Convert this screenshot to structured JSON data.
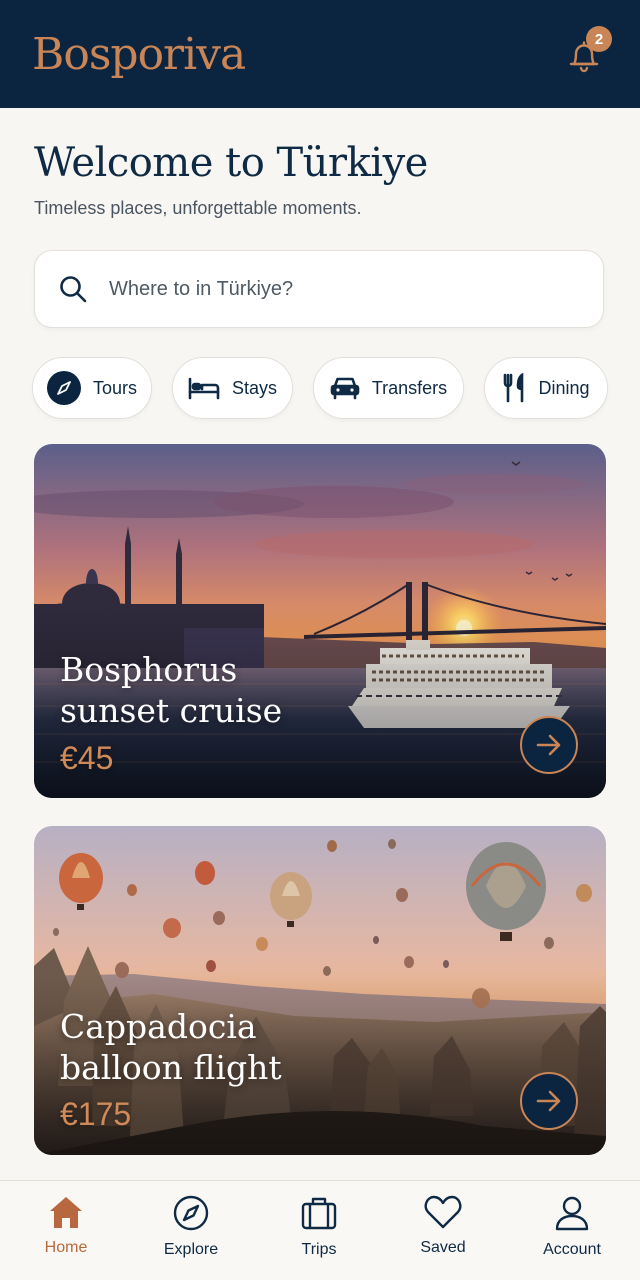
{
  "header": {
    "logo": "Bosporiva",
    "notifications_count": "2",
    "bell_icon": "bell-icon"
  },
  "welcome": {
    "title": "Welcome to Türkiye",
    "subtitle": "Timeless places, unforgettable moments."
  },
  "search": {
    "placeholder": "Where to in Türkiye?",
    "value": "",
    "icon": "search-icon"
  },
  "categories": [
    {
      "label": "Tours",
      "icon": "compass-icon"
    },
    {
      "label": "Stays",
      "icon": "bed-icon"
    },
    {
      "label": "Transfers",
      "icon": "car-icon"
    },
    {
      "label": "Dining",
      "icon": "fork-knife-icon"
    }
  ],
  "cards": [
    {
      "title_line1": "Bosphorus",
      "title_line2": "sunset cruise",
      "price": "€45",
      "icon": "arrow-right-icon"
    },
    {
      "title_line1": "Cappadocia",
      "title_line2": "balloon flight",
      "price": "€175",
      "icon": "arrow-right-icon"
    }
  ],
  "bottom_nav": [
    {
      "label": "Home",
      "icon": "home-icon",
      "active": true
    },
    {
      "label": "Explore",
      "icon": "compass-icon",
      "active": false
    },
    {
      "label": "Trips",
      "icon": "suitcase-icon",
      "active": false
    },
    {
      "label": "Saved",
      "icon": "heart-icon",
      "active": false
    },
    {
      "label": "Account",
      "icon": "user-icon",
      "active": false
    }
  ],
  "colors": {
    "header_bg": "#0b2540",
    "accent": "#c98556",
    "text_primary": "#0f2a44",
    "background": "#f8f6f2"
  }
}
